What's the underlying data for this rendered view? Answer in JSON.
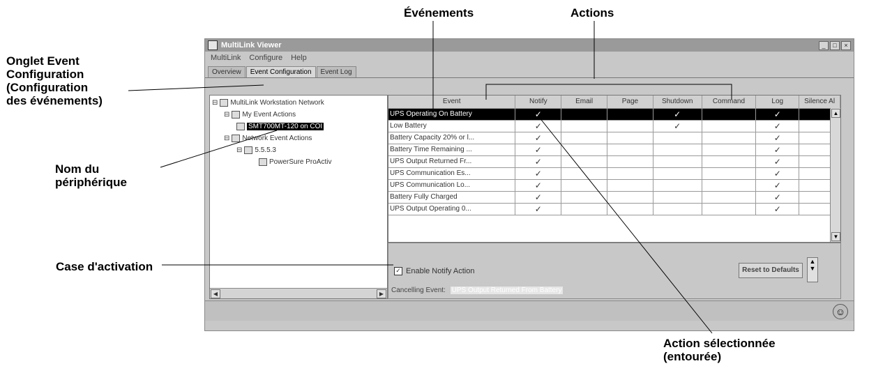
{
  "callouts": {
    "evenements": "Événements",
    "actions": "Actions",
    "onglet": "Onglet Event\nConfiguration\n(Configuration\ndes événements)",
    "nom": "Nom du\npériphérique",
    "case": "Case d'activation",
    "action_sel": "Action sélectionnée\n(entourée)"
  },
  "window": {
    "title": "MultiLink Viewer",
    "buttons": [
      "_",
      "□",
      "×"
    ],
    "menu": [
      "MultiLink",
      "Configure",
      "Help"
    ],
    "tabs": [
      "Overview",
      "Event Configuration",
      "Event Log"
    ],
    "active_tab": "Event Configuration"
  },
  "tree": {
    "nodes": [
      {
        "label": "MultiLink Workstation Network",
        "expand": "⊟"
      },
      {
        "label": "My Event Actions",
        "expand": "⊟"
      },
      {
        "label": "SMT700MT-120 on COI",
        "expand": ""
      },
      {
        "label": "Network Event Actions",
        "expand": "⊟"
      },
      {
        "label": "5.5.5.3",
        "expand": "⊟"
      },
      {
        "label": "PowerSure ProActiv",
        "expand": ""
      }
    ]
  },
  "table": {
    "columns": [
      "Event",
      "Notify",
      "Email",
      "Page",
      "Shutdown",
      "Command",
      "Log",
      "Silence Al"
    ],
    "rows": [
      {
        "event": "UPS Operating On Battery",
        "checks": [
          "✓",
          "",
          "",
          "✓",
          "",
          "✓",
          ""
        ]
      },
      {
        "event": "Low Battery",
        "checks": [
          "✓",
          "",
          "",
          "✓",
          "",
          "✓",
          ""
        ]
      },
      {
        "event": "Battery Capacity 20% or l...",
        "checks": [
          "✓",
          "",
          "",
          "",
          "",
          "✓",
          ""
        ]
      },
      {
        "event": "Battery Time Remaining ...",
        "checks": [
          "✓",
          "",
          "",
          "",
          "",
          "✓",
          ""
        ]
      },
      {
        "event": "UPS Output Returned Fr...",
        "checks": [
          "✓",
          "",
          "",
          "",
          "",
          "✓",
          ""
        ]
      },
      {
        "event": "UPS Communication Es...",
        "checks": [
          "✓",
          "",
          "",
          "",
          "",
          "✓",
          ""
        ]
      },
      {
        "event": "UPS Communication Lo...",
        "checks": [
          "✓",
          "",
          "",
          "",
          "",
          "✓",
          ""
        ]
      },
      {
        "event": "Battery Fully Charged",
        "checks": [
          "✓",
          "",
          "",
          "",
          "",
          "✓",
          ""
        ]
      },
      {
        "event": "UPS Output Operating 0...",
        "checks": [
          "✓",
          "",
          "",
          "",
          "",
          "✓",
          ""
        ]
      }
    ]
  },
  "lower": {
    "checkbox_mark": "✓",
    "enable_label": "Enable Notify Action",
    "reset_label": "Reset to Defaults",
    "cancelling_label": "Cancelling Event:",
    "cancelling_value": "UPS Output Returned From Battery"
  },
  "status": {
    "smiley": "☺"
  }
}
